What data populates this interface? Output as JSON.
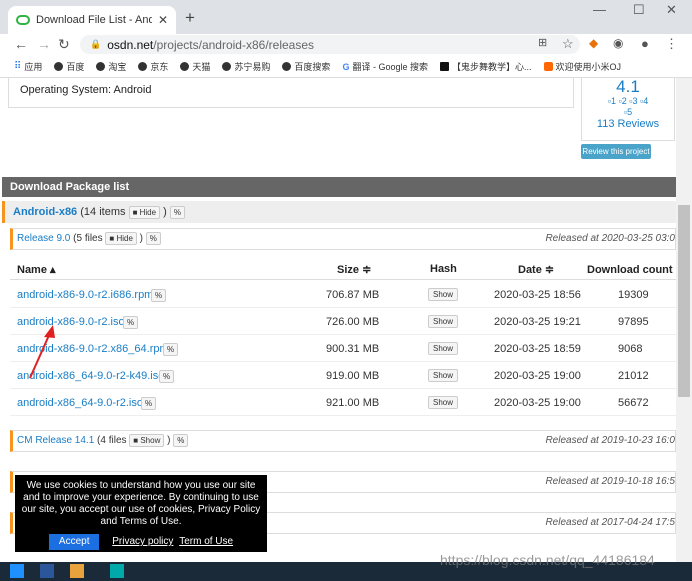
{
  "browser": {
    "tab_title": "Download File List - Android-x",
    "url_host": "osdn.net",
    "url_path": "/projects/android-x86/releases",
    "bookmarks": [
      "应用",
      "百度",
      "淘宝",
      "京东",
      "天猫",
      "苏宁易购",
      "百度搜索",
      "翻译 - Google 搜索",
      "【鬼步舞教学】心...",
      "欢迎使用小米OJ"
    ]
  },
  "project": {
    "operating_system": "Operating System: Android",
    "rating": "4.1",
    "star_labels": [
      "1",
      "2",
      "3",
      "4",
      "5"
    ],
    "reviews": "113 Reviews",
    "review_button": "Review this project"
  },
  "download": {
    "header": "Download Package list",
    "group_name": "Android-x86",
    "group_count": "(14 items",
    "hide_label": "Hide",
    "show_label": "Show",
    "release_9": {
      "name": "Release 9.0",
      "count": "(5 files",
      "date": "Released at 2020-03-25 03:0"
    },
    "columns": {
      "name": "Name ▴",
      "size": "Size ≑",
      "hash": "Hash",
      "date": "Date ≑",
      "count": "Download count ≑"
    },
    "files": [
      {
        "name": "android-x86-9.0-r2.i686.rpm",
        "size": "706.87 MB",
        "date": "2020-03-25 18:56",
        "count": "19309"
      },
      {
        "name": "android-x86-9.0-r2.iso",
        "size": "726.00 MB",
        "date": "2020-03-25 19:21",
        "count": "97895"
      },
      {
        "name": "android-x86-9.0-r2.x86_64.rpm",
        "size": "900.31 MB",
        "date": "2020-03-25 18:59",
        "count": "9068"
      },
      {
        "name": "android-x86_64-9.0-r2-k49.iso",
        "size": "919.00 MB",
        "date": "2020-03-25 19:00",
        "count": "21012"
      },
      {
        "name": "android-x86_64-9.0-r2.iso",
        "size": "921.00 MB",
        "date": "2020-03-25 19:00",
        "count": "56672"
      }
    ],
    "cm_release": {
      "name": "CM Release 14.1",
      "count": "(4 files",
      "date": "Released at 2019-10-23 16:0"
    },
    "other_release_1": {
      "date": "Released at 2019-10-18 16:5"
    },
    "other_release_2": {
      "date": "Released at 2017-04-24 17:5"
    }
  },
  "cookie": {
    "message": "We use cookies to understand how you use our site and to improve your experience. By continuing to use our site, you accept our use of cookies, Privacy Policy and Terms of Use.",
    "accept": "Accept",
    "privacy_link": "Privacy policy",
    "terms_link": "Term of Use"
  },
  "overlay": {
    "watermark": "https://blog.csdn.net/qq_44186184",
    "arrow_color": "#e02020"
  }
}
